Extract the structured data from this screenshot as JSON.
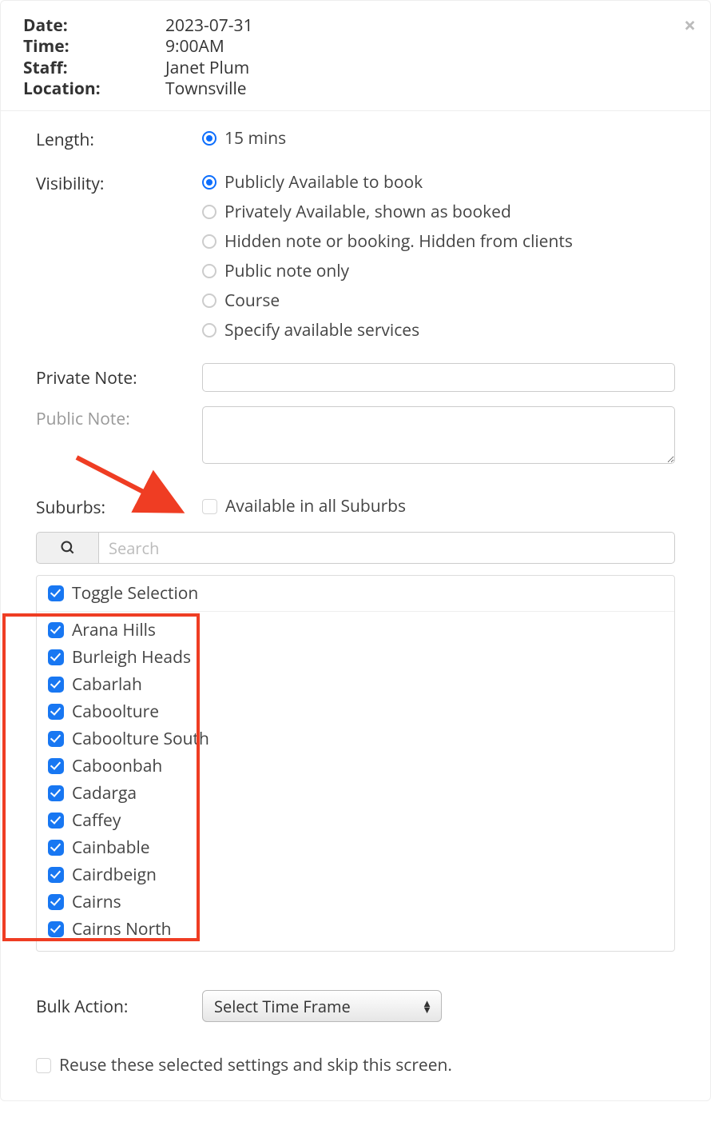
{
  "header": {
    "labels": {
      "date": "Date:",
      "time": "Time:",
      "staff": "Staff:",
      "location": "Location:"
    },
    "values": {
      "date": "2023-07-31",
      "time": "9:00AM",
      "staff": "Janet Plum",
      "location": "Townsville"
    }
  },
  "form": {
    "length_label": "Length:",
    "length_options": [
      "15 mins"
    ],
    "visibility_label": "Visibility:",
    "visibility_options": [
      "Publicly Available to book",
      "Privately Available, shown as booked",
      "Hidden note or booking. Hidden from clients",
      "Public note only",
      "Course",
      "Specify available services"
    ],
    "private_note_label": "Private Note:",
    "public_note_label": "Public Note:",
    "suburbs_label": "Suburbs:",
    "all_suburbs_label": "Available in all Suburbs",
    "search_placeholder": "Search",
    "toggle_label": "Toggle Selection",
    "suburbs": [
      "Arana Hills",
      "Burleigh Heads",
      "Cabarlah",
      "Caboolture",
      "Caboolture South",
      "Caboonbah",
      "Cadarga",
      "Caffey",
      "Cainbable",
      "Cairdbeign",
      "Cairns",
      "Cairns North"
    ],
    "bulk_action_label": "Bulk Action:",
    "bulk_action_selected": "Select Time Frame",
    "reuse_label": "Reuse these selected settings and skip this screen."
  }
}
